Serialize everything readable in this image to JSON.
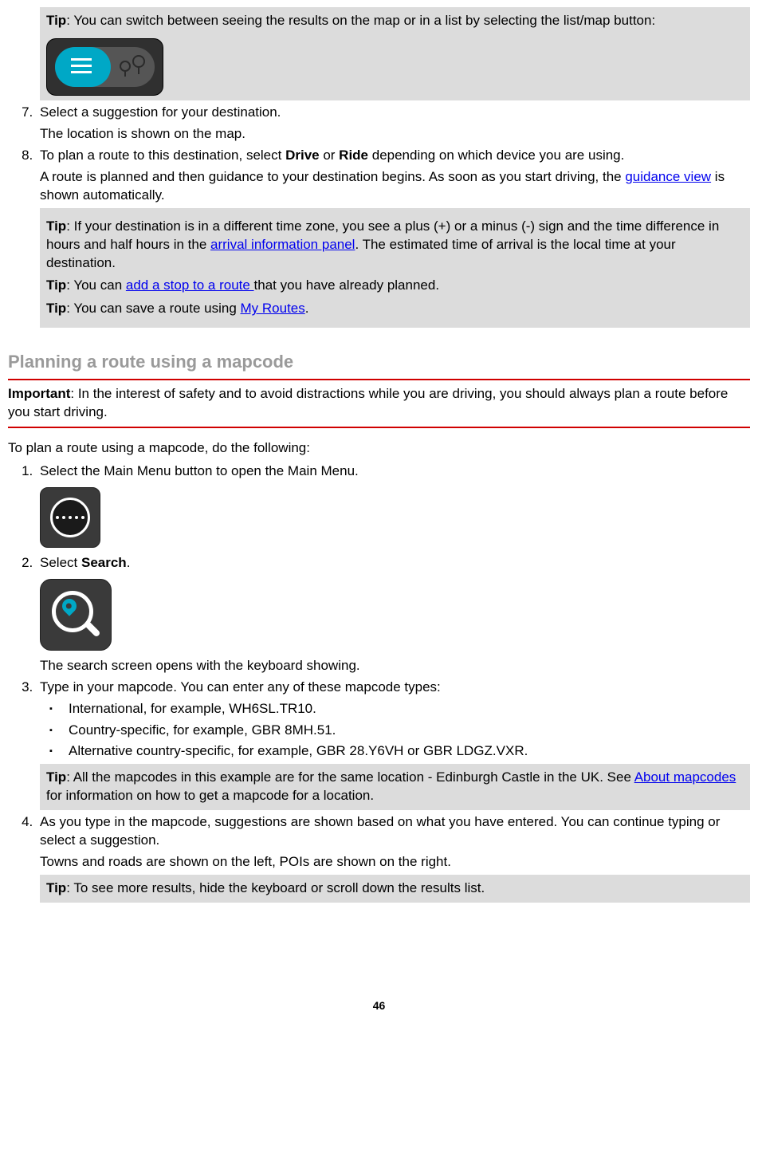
{
  "tip1_label": "Tip",
  "tip1_text": ": You can switch between seeing the results on the map or in a list by selecting the list/map button:",
  "step7_a": "Select a suggestion for your destination.",
  "step7_b": "The location is shown on the map.",
  "step8_a_pre": "To plan a route to this destination, select ",
  "step8_a_drive": "Drive",
  "step8_a_or": " or ",
  "step8_a_ride": "Ride",
  "step8_a_post": " depending on which device you are using.",
  "step8_b_pre": "A route is planned and then guidance to your destination begins. As soon as you start driving, the ",
  "step8_b_link": "guidance view",
  "step8_b_post": " is shown automatically.",
  "tip2_label": "Tip",
  "tip2_a_pre": ": If your destination is in a different time zone, you see a plus (+) or a minus (-) sign and the time difference in hours and half hours in the ",
  "tip2_a_link": "arrival information panel",
  "tip2_a_post": ". The estimated time of arrival is the local time at your destination.",
  "tip2_b_label": "Tip",
  "tip2_b_pre": ": You can ",
  "tip2_b_link": "add a stop to a route ",
  "tip2_b_post": " that you have already planned.",
  "tip2_c_label": "Tip",
  "tip2_c_pre": ": You can save a route using ",
  "tip2_c_link": "My Routes",
  "tip2_c_post": ".",
  "section_heading": "Planning a route using a mapcode",
  "important_label": "Important",
  "important_text": ": In the interest of safety and to avoid distractions while you are driving, you should always plan a route before you start driving.",
  "intro2": "To plan a route using a mapcode, do the following:",
  "s1": "Select the Main Menu button to open the Main Menu.",
  "s2_pre": "Select ",
  "s2_bold": "Search",
  "s2_post": ".",
  "s2_after": "The search screen opens with the keyboard showing.",
  "s3": "Type in your mapcode. You can enter any of these mapcode types:",
  "b1": "International, for example, WH6SL.TR10.",
  "b2": "Country-specific, for example, GBR 8MH.51.",
  "b3": "Alternative country-specific, for example, GBR 28.Y6VH or GBR LDGZ.VXR.",
  "tip3_label": "Tip",
  "tip3_pre": ": All the mapcodes in this example are for the same location - Edinburgh Castle in the UK. See ",
  "tip3_link": "About mapcodes",
  "tip3_post": " for information on how to get a mapcode for a location.",
  "s4_a": "As you type in the mapcode, suggestions are shown based on what you have entered. You can continue typing or select a suggestion.",
  "s4_b": "Towns and roads are shown on the left, POIs are shown on the right.",
  "tip4_label": "Tip",
  "tip4_text": ": To see more results, hide the keyboard or scroll down the results list.",
  "page_number": "46"
}
